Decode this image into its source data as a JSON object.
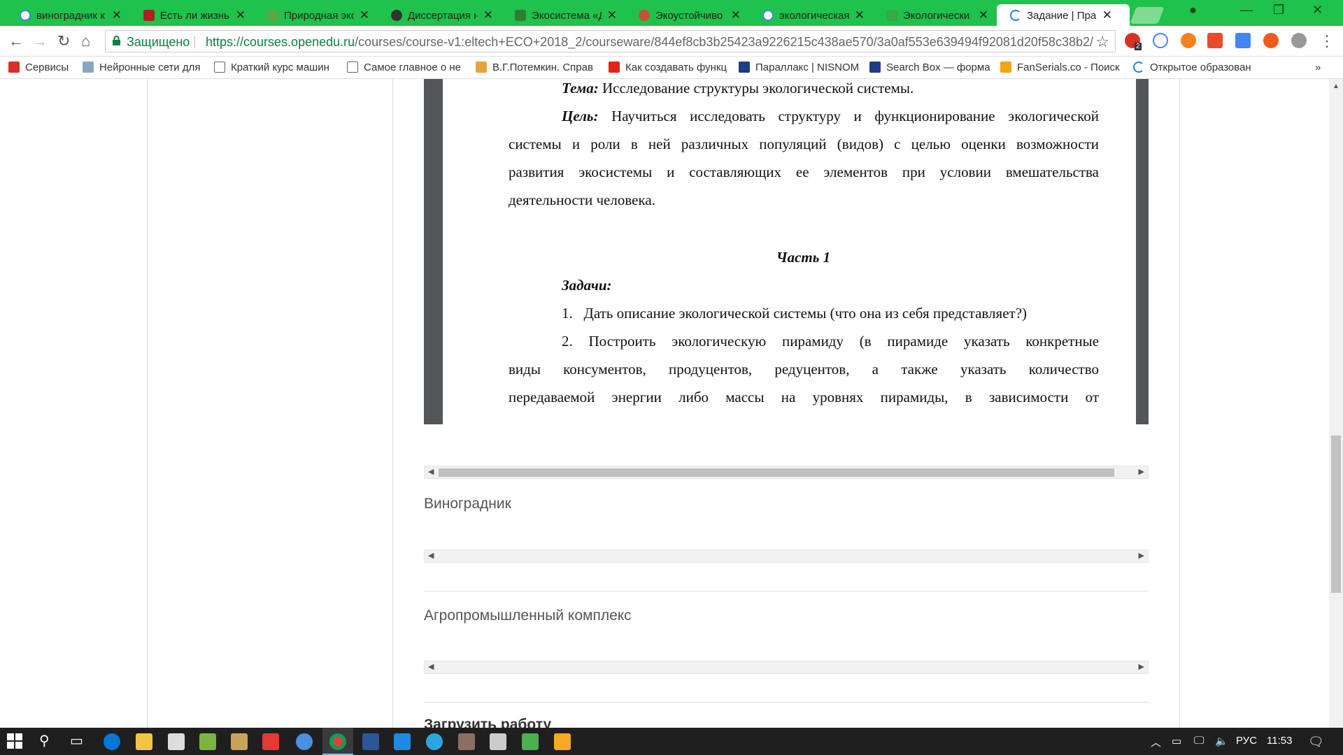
{
  "browser": {
    "tabs": [
      {
        "title": "виноградник к",
        "icon_color": "#4285f4"
      },
      {
        "title": "Есть ли жизнь",
        "icon_color": "#b01f24"
      },
      {
        "title": "Природная экс",
        "icon_color": "#5aa843"
      },
      {
        "title": "Диссертация н",
        "icon_color": "#333333"
      },
      {
        "title": "Экосистема «Д",
        "icon_color": "#2e7d32"
      },
      {
        "title": "Экоустойчиво",
        "icon_color": "#c94e3b"
      },
      {
        "title": "экологическая",
        "icon_color": "#4285f4"
      },
      {
        "title": "Экологически",
        "icon_color": "#39a847"
      },
      {
        "title": "Задание | Пра",
        "icon_color": "#2a7fd4"
      }
    ],
    "secure_label": "Защищено",
    "url_host": "https://courses.openedu.ru",
    "url_path": "/courses/course-v1:eltech+ECO+2018_2/courseware/844ef8cb3b25423a9226215c438ae570/3a0af553e639494f92081d20f58c38b2/",
    "extension_badge": "2"
  },
  "bookmarks": [
    {
      "label": "Сервисы",
      "icon": "apps-grid-icon",
      "color": "#d93025"
    },
    {
      "label": "Нейронные сети для",
      "icon": "h-icon",
      "color": "#8aa6c1"
    },
    {
      "label": "Краткий курс машин",
      "icon": "page-icon",
      "color": "#ffffff"
    },
    {
      "label": "Самое главное о не",
      "icon": "page-icon",
      "color": "#ffffff"
    },
    {
      "label": "В.Г.Потемкин. Справ",
      "icon": "book-icon",
      "color": "#e8a33d"
    },
    {
      "label": "Как создавать функц",
      "icon": "youtube-icon",
      "color": "#e62117"
    },
    {
      "label": "Параллакс | NISNOM",
      "icon": "arrow-icon",
      "color": "#1f3c88"
    },
    {
      "label": "Search Box — форма",
      "icon": "arrow-icon",
      "color": "#1f3c88"
    },
    {
      "label": "FanSerials.co - Поиск",
      "icon": "fs-icon",
      "color": "#f2a316"
    },
    {
      "label": "Открытое образован",
      "icon": "loading-icon",
      "color": "#2a7fd4"
    }
  ],
  "document": {
    "topic_label": "Тема:",
    "topic_text": "Исследование структуры экологической системы.",
    "goal_label": "Цель:",
    "goal_line1": "Научиться исследовать структуру и функционирование экологической",
    "goal_line2": "системы и роли в ней различных популяций (видов) с целью оценки возможности",
    "goal_line3": "развития экосистемы и составляющих ее элементов при условии вмешательства",
    "goal_line4": "деятельности человека.",
    "part_heading": "Часть 1",
    "tasks_label": "Задачи:",
    "task1_num": "1.",
    "task1_text": "Дать описание экологической системы (что она из себя представляет?)",
    "task2_num": "2.",
    "task2_line1": "Построить экологическую пирамиду (в пирамиде указать конкретные",
    "task2_line2": "виды консументов, продуцентов, редуцентов, а также указать количество",
    "task2_line3": "передаваемой энергии либо массы на уровнях пирамиды, в зависимости от"
  },
  "sections": {
    "vineyard_title": "Виноградник",
    "agro_title": "Агропромышленный комплекс",
    "upload_title": "Загрузить работу"
  },
  "taskbar": {
    "language": "РУС",
    "time": "11:53"
  }
}
